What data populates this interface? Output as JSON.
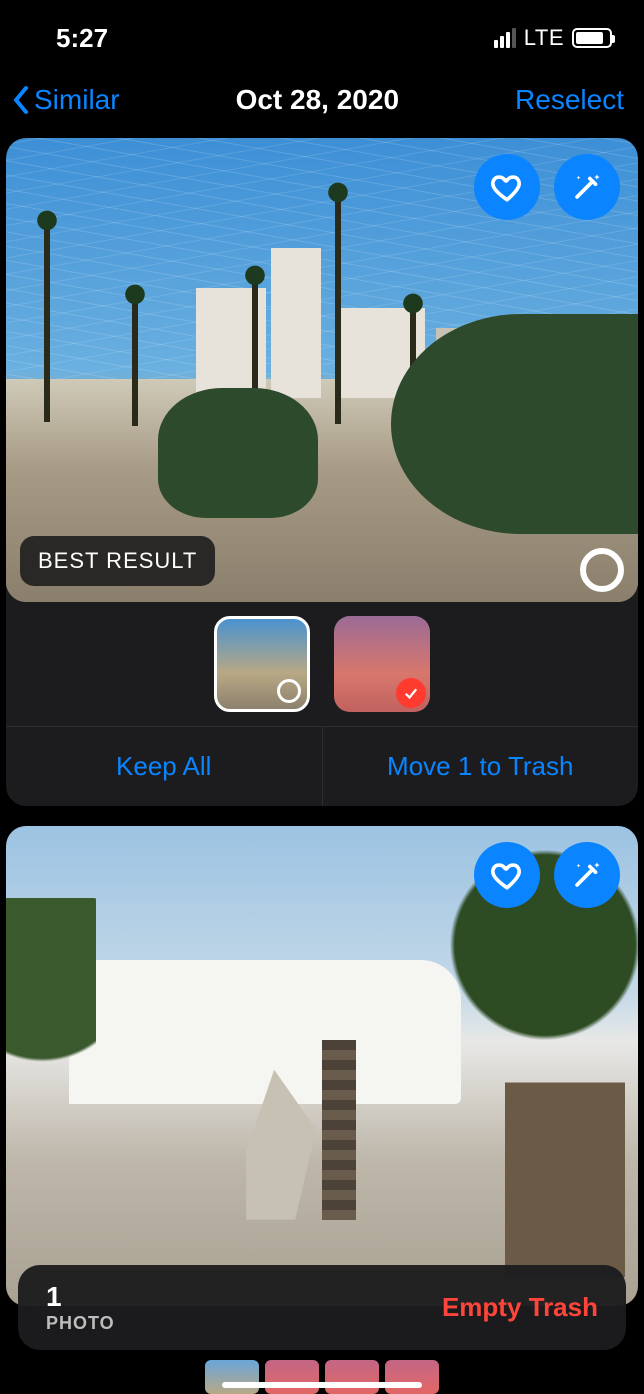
{
  "status": {
    "time": "5:27",
    "network": "LTE"
  },
  "nav": {
    "back_label": "Similar",
    "title": "Oct 28, 2020",
    "reselect_label": "Reselect"
  },
  "card1": {
    "best_badge": "BEST RESULT",
    "keep_label": "Keep All",
    "trash_label": "Move 1 to Trash"
  },
  "trash_bar": {
    "count": "1",
    "unit": "PHOTO",
    "action": "Empty Trash"
  }
}
